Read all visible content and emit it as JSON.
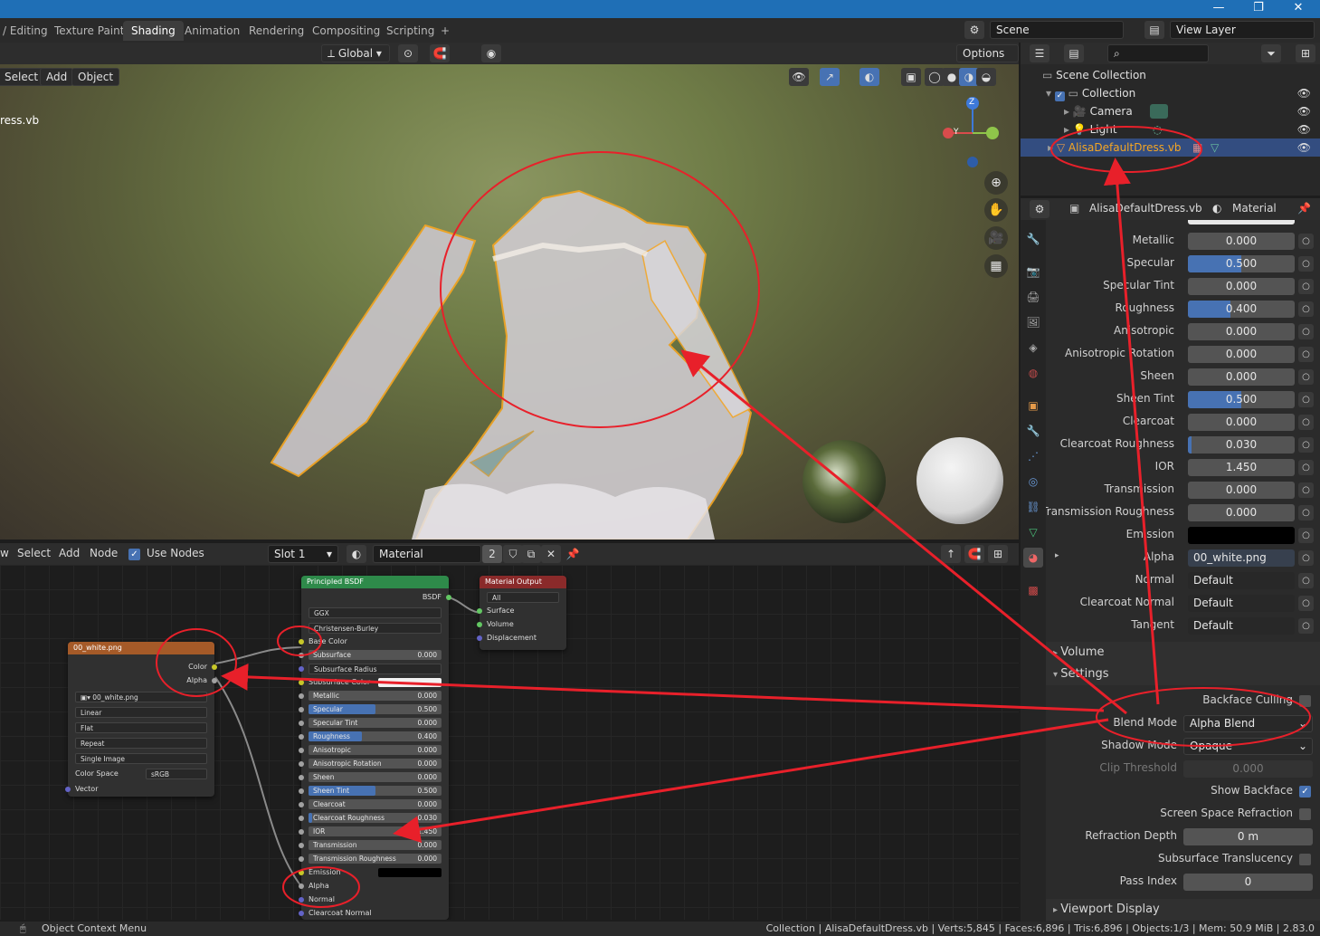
{
  "workspace_tabs": [
    "/ Editing",
    "Texture Paint",
    "Shading",
    "Animation",
    "Rendering",
    "Compositing",
    "Scripting",
    "+"
  ],
  "active_tab": "Shading",
  "scene": {
    "label": "Scene",
    "view_layer": "View Layer"
  },
  "viewport": {
    "transform_orientation": "Global",
    "options_label": "Options",
    "menu": [
      "Select",
      "Add",
      "Object"
    ],
    "object_name_partial": "ress.vb",
    "gizmo": {
      "z": "Z",
      "y": "Y"
    }
  },
  "node_editor": {
    "menu": [
      "w",
      "Select",
      "Add",
      "Node"
    ],
    "use_nodes_label": "Use Nodes",
    "slot": "Slot 1",
    "material": "Material",
    "users": "2",
    "image_node": {
      "title": "00_white.png",
      "outputs": [
        "Color",
        "Alpha"
      ],
      "image": "00_white.png",
      "interpolation": "Linear",
      "projection": "Flat",
      "extension": "Repeat",
      "source": "Single Image",
      "color_space_label": "Color Space",
      "color_space": "sRGB",
      "vector": "Vector"
    },
    "bsdf_node": {
      "title": "Principled BSDF",
      "output": "BSDF",
      "distribution": "GGX",
      "subsurface_method": "Christensen-Burley",
      "base_color": "Base Color",
      "rows": [
        {
          "label": "Subsurface",
          "value": "0.000",
          "fill": 0
        },
        {
          "label": "Subsurface Radius",
          "value": "",
          "fill": 0
        },
        {
          "label": "Subsurface Color",
          "value": "",
          "fill": 0
        },
        {
          "label": "Metallic",
          "value": "0.000",
          "fill": 0
        },
        {
          "label": "Specular",
          "value": "0.500",
          "fill": 0.5
        },
        {
          "label": "Specular Tint",
          "value": "0.000",
          "fill": 0
        },
        {
          "label": "Roughness",
          "value": "0.400",
          "fill": 0.4
        },
        {
          "label": "Anisotropic",
          "value": "0.000",
          "fill": 0
        },
        {
          "label": "Anisotropic Rotation",
          "value": "0.000",
          "fill": 0
        },
        {
          "label": "Sheen",
          "value": "0.000",
          "fill": 0
        },
        {
          "label": "Sheen Tint",
          "value": "0.500",
          "fill": 0.5
        },
        {
          "label": "Clearcoat",
          "value": "0.000",
          "fill": 0
        },
        {
          "label": "Clearcoat Roughness",
          "value": "0.030",
          "fill": 0.03
        },
        {
          "label": "IOR",
          "value": "1.450",
          "fill": 0
        },
        {
          "label": "Transmission",
          "value": "0.000",
          "fill": 0
        },
        {
          "label": "Transmission Roughness",
          "value": "0.000",
          "fill": 0
        }
      ],
      "emission": "Emission",
      "alpha": "Alpha",
      "normal": "Normal",
      "clearcoat_normal": "Clearcoat Normal"
    },
    "output_node": {
      "title": "Material Output",
      "target": "All",
      "inputs": [
        "Surface",
        "Volume",
        "Displacement"
      ]
    }
  },
  "outliner": {
    "items": [
      {
        "name": "Scene Collection"
      },
      {
        "name": "Collection"
      },
      {
        "name": "Camera"
      },
      {
        "name": "Light"
      },
      {
        "name": "AlisaDefaultDress.vb"
      }
    ]
  },
  "properties": {
    "object": "AlisaDefaultDress.vb",
    "material": "Material",
    "rows": [
      {
        "label": "Metallic",
        "value": "0.000",
        "fill": 0
      },
      {
        "label": "Specular",
        "value": "0.500",
        "fill": 0.5
      },
      {
        "label": "Specular Tint",
        "value": "0.000",
        "fill": 0
      },
      {
        "label": "Roughness",
        "value": "0.400",
        "fill": 0.4
      },
      {
        "label": "Anisotropic",
        "value": "0.000",
        "fill": 0
      },
      {
        "label": "Anisotropic Rotation",
        "value": "0.000",
        "fill": 0
      },
      {
        "label": "Sheen",
        "value": "0.000",
        "fill": 0
      },
      {
        "label": "Sheen Tint",
        "value": "0.500",
        "fill": 0.5
      },
      {
        "label": "Clearcoat",
        "value": "0.000",
        "fill": 0
      },
      {
        "label": "Clearcoat Roughness",
        "value": "0.030",
        "fill": 0.03
      },
      {
        "label": "IOR",
        "value": "1.450",
        "fill": 0
      },
      {
        "label": "Transmission",
        "value": "0.000",
        "fill": 0
      },
      {
        "label": "Transmission Roughness",
        "value": "0.000",
        "fill": 0
      }
    ],
    "emission_label": "Emission",
    "alpha": {
      "label": "Alpha",
      "value": "00_white.png"
    },
    "normal": {
      "label": "Normal",
      "value": "Default"
    },
    "clearcoat_normal": {
      "label": "Clearcoat Normal",
      "value": "Default"
    },
    "tangent": {
      "label": "Tangent",
      "value": "Default"
    },
    "volume_section": "Volume",
    "settings_section": "Settings",
    "backface_culling": "Backface Culling",
    "blend_mode": {
      "label": "Blend Mode",
      "value": "Alpha Blend"
    },
    "shadow_mode": {
      "label": "Shadow Mode",
      "value": "Opaque"
    },
    "clip_threshold": {
      "label": "Clip Threshold",
      "value": "0.000"
    },
    "show_backface": "Show Backface",
    "screen_space_refraction": "Screen Space Refraction",
    "refraction_depth": {
      "label": "Refraction Depth",
      "value": "0 m"
    },
    "subsurface_translucency": "Subsurface Translucency",
    "pass_index": {
      "label": "Pass Index",
      "value": "0"
    },
    "viewport_display_section": "Viewport Display"
  },
  "statusbar": {
    "left": "Object Context Menu",
    "right": "Collection | AlisaDefaultDress.vb | Verts:5,845 | Faces:6,896 | Tris:6,896 | Objects:1/3 | Mem: 50.9 MiB | 2.83.0"
  },
  "colors": {
    "accent": "#4772b3",
    "annotation": "#e8202a",
    "selection": "#f5a623",
    "title_bar": "#1f6fb6"
  }
}
